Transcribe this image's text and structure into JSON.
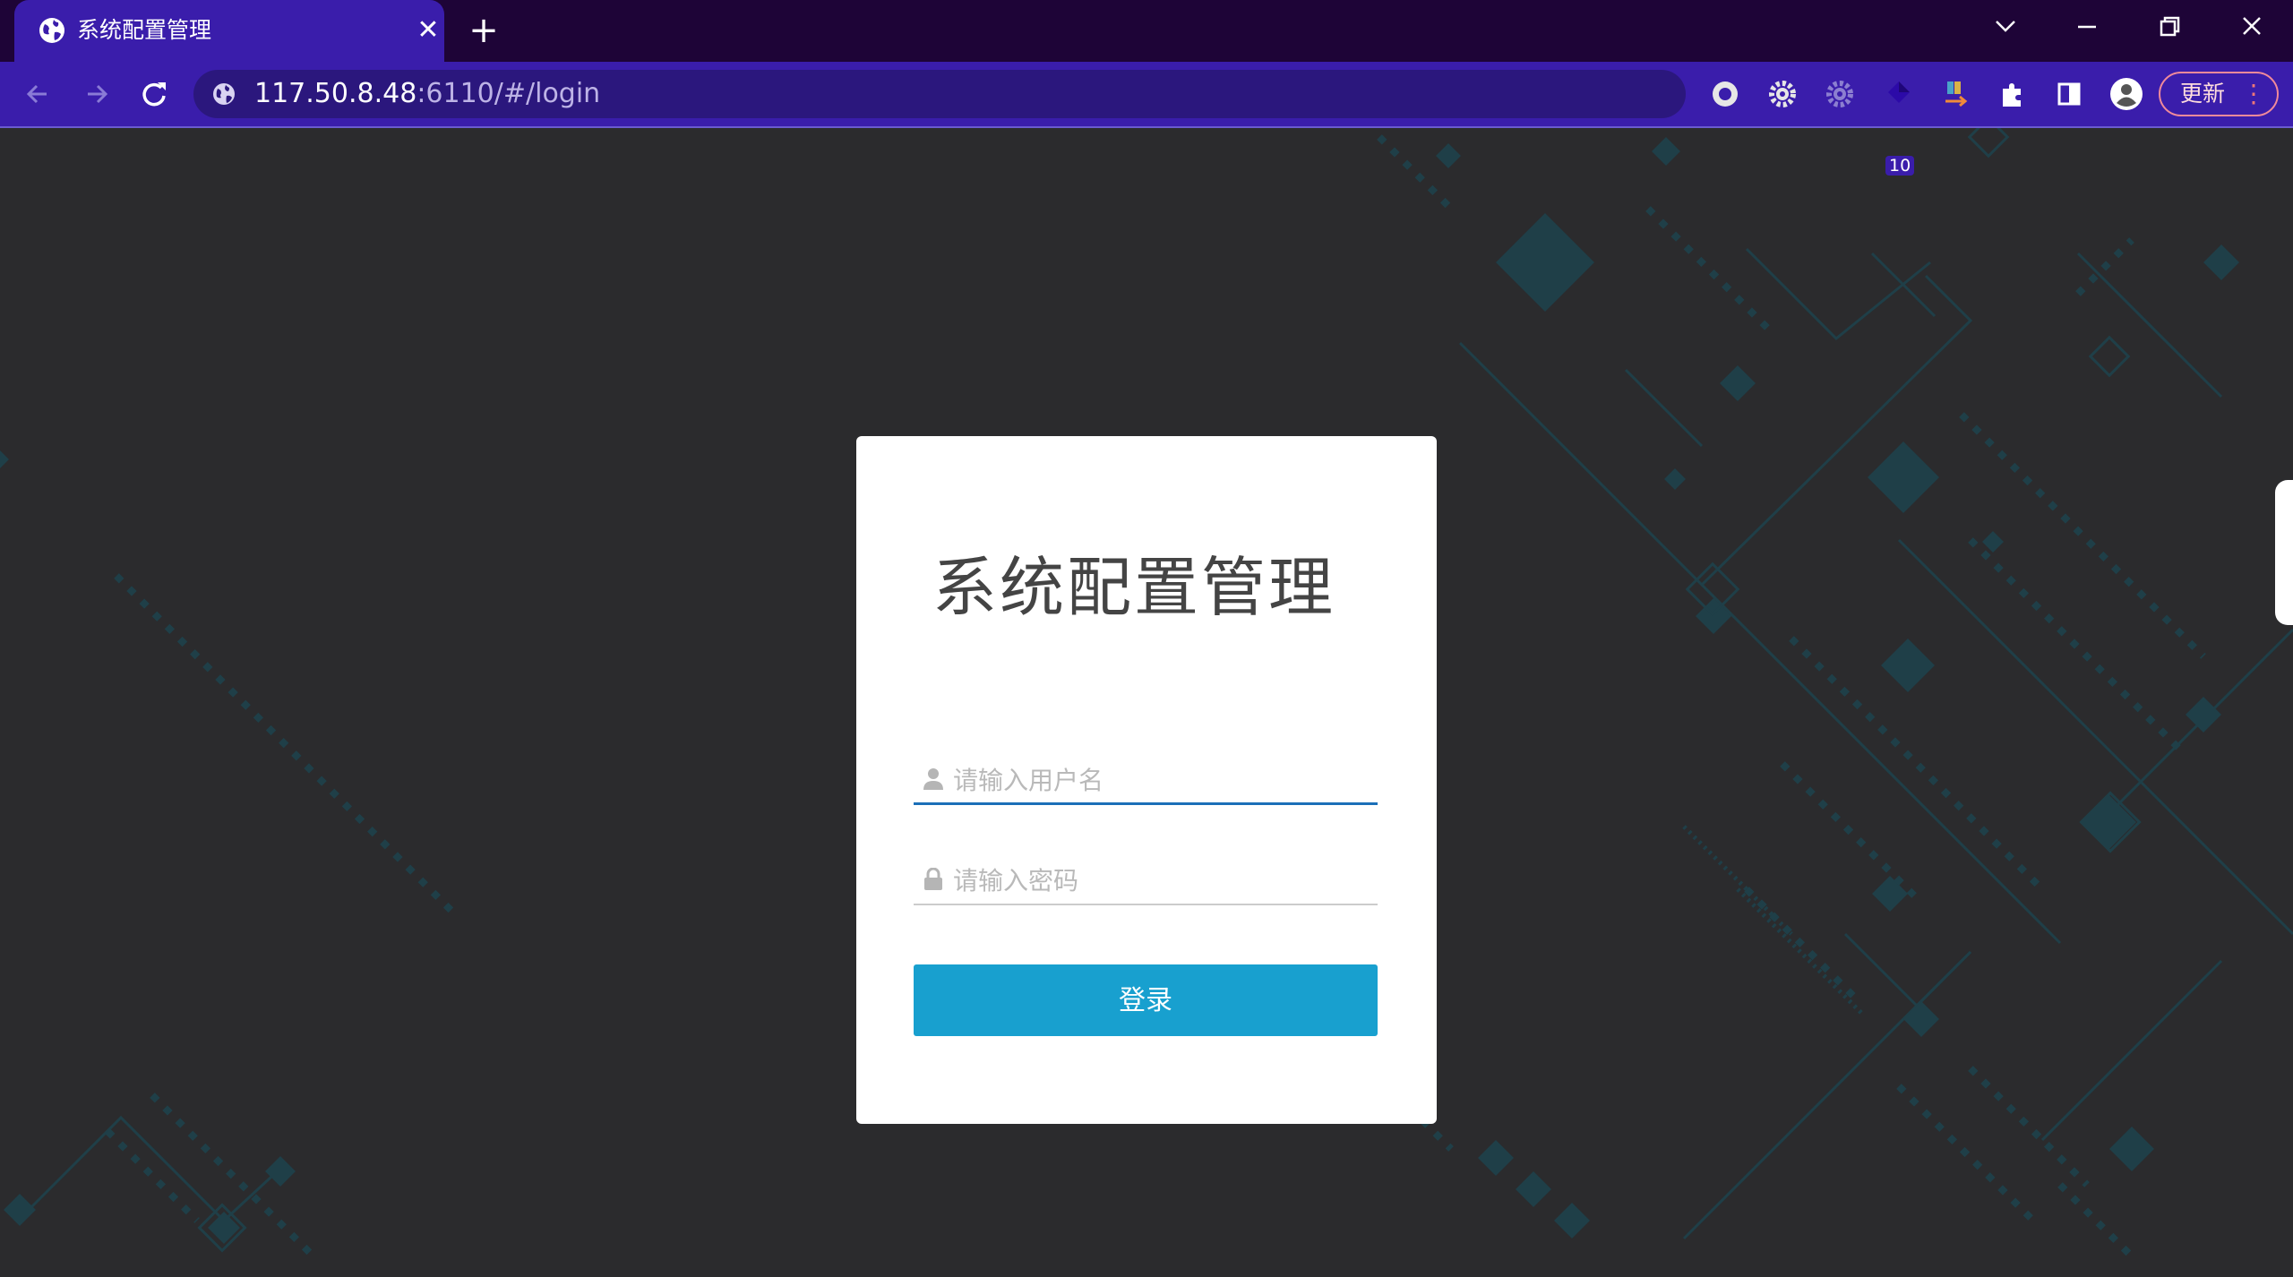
{
  "browser": {
    "tab_title": "系统配置管理",
    "tab_close": "✕",
    "new_tab": "+",
    "url_host": "117.50.8.48",
    "url_rest": ":6110/#/login",
    "extension_badge": "10",
    "update_label": "更新",
    "menu_dots": "⋮"
  },
  "login": {
    "title": "系统配置管理",
    "username_placeholder": "请输入用户名",
    "username_value": "",
    "password_placeholder": "请输入密码",
    "password_value": "",
    "submit_label": "登录"
  },
  "colors": {
    "tab_bar": "#1e0437",
    "toolbar": "#3a1dab",
    "page_background": "#2b2b2d",
    "pattern": "#1e4049",
    "button": "#18a0cf",
    "focus_underline": "#1b6fb8"
  }
}
